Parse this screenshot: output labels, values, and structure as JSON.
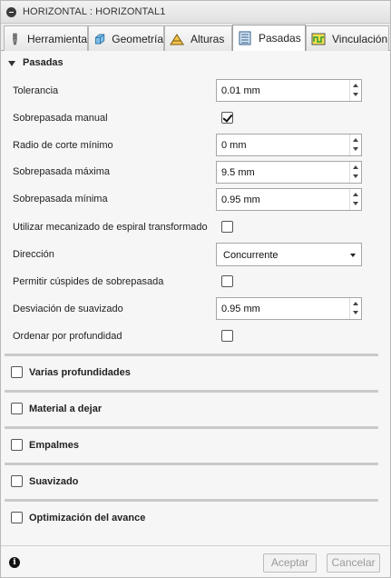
{
  "window": {
    "title": "HORIZONTAL : HORIZONTAL1"
  },
  "tabs": [
    {
      "label": "Herramienta",
      "icon": "tool-icon"
    },
    {
      "label": "Geometría",
      "icon": "geometry-icon"
    },
    {
      "label": "Alturas",
      "icon": "heights-icon"
    },
    {
      "label": "Pasadas",
      "icon": "passes-icon",
      "active": true
    },
    {
      "label": "Vinculación",
      "icon": "linking-icon"
    }
  ],
  "passes": {
    "title": "Pasadas",
    "tolerance": {
      "label": "Tolerancia",
      "value": "0.01 mm"
    },
    "manual_stepover": {
      "label": "Sobrepasada manual",
      "checked": true
    },
    "min_cut_radius": {
      "label": "Radio de corte mínimo",
      "value": "0 mm"
    },
    "max_stepover": {
      "label": "Sobrepasada máxima",
      "value": "9.5 mm"
    },
    "min_stepover": {
      "label": "Sobrepasada mínima",
      "value": "0.95 mm"
    },
    "spiral": {
      "label": "Utilizar mecanizado de espiral transformado",
      "checked": false
    },
    "direction": {
      "label": "Dirección",
      "value": "Concurrente"
    },
    "cusps": {
      "label": "Permitir cúspides de sobrepasada",
      "checked": false
    },
    "smoothing_deviation": {
      "label": "Desviación de suavizado",
      "value": "0.95 mm"
    },
    "order_by_depth": {
      "label": "Ordenar por profundidad",
      "checked": false
    }
  },
  "groups": [
    {
      "label": "Varias profundidades"
    },
    {
      "label": "Material a dejar"
    },
    {
      "label": "Empalmes"
    },
    {
      "label": "Suavizado"
    },
    {
      "label": "Optimización del avance"
    }
  ],
  "footer": {
    "info": "i",
    "ok_label": "Aceptar",
    "cancel_label": "Cancelar"
  }
}
